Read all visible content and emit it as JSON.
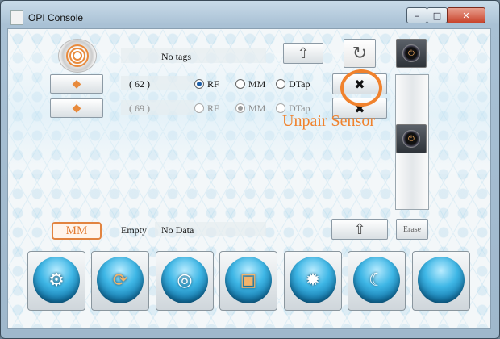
{
  "window": {
    "title": "OPI Console",
    "min_label": "–",
    "max_label": "□",
    "close_label": "✕"
  },
  "top_row": {
    "tag_status": "No tags",
    "refresh_icon": "refresh-icon",
    "upload_icon": "up-arrow-icon"
  },
  "sensors": [
    {
      "count": "( 62 )",
      "options": [
        "RF",
        "MM",
        "DTap"
      ],
      "selected": "RF",
      "enabled": true
    },
    {
      "count": "( 69 )",
      "options": [
        "RF",
        "MM",
        "DTap"
      ],
      "selected": "MM",
      "enabled": false
    }
  ],
  "annotation": {
    "text": "Unpair Sensor",
    "color": "#f0822d"
  },
  "mm_section": {
    "badge": "MM",
    "label": "Empty",
    "value": "No Data",
    "erase_label": "Erase"
  },
  "bottom_buttons": [
    {
      "icon": "gear-icon"
    },
    {
      "icon": "sync-icon"
    },
    {
      "icon": "waveform-icon"
    },
    {
      "icon": "memory-card-icon"
    },
    {
      "icon": "eye-settings-icon"
    },
    {
      "icon": "moon-icon"
    },
    {
      "icon": "blank-orb-icon"
    }
  ],
  "colors": {
    "accent": "#f0822d",
    "orb": "#3fb7e6"
  }
}
